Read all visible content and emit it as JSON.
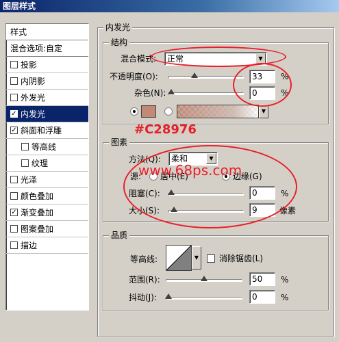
{
  "window": {
    "title": "图层样式"
  },
  "sidebar": {
    "header": "样式",
    "blend_options": "混合选项:自定",
    "items": [
      {
        "label": "投影",
        "checked": false,
        "sub": false,
        "selected": false
      },
      {
        "label": "内阴影",
        "checked": false,
        "sub": false,
        "selected": false
      },
      {
        "label": "外发光",
        "checked": false,
        "sub": false,
        "selected": false
      },
      {
        "label": "内发光",
        "checked": true,
        "sub": false,
        "selected": true
      },
      {
        "label": "斜面和浮雕",
        "checked": true,
        "sub": false,
        "selected": false
      },
      {
        "label": "等高线",
        "checked": false,
        "sub": true,
        "selected": false
      },
      {
        "label": "纹理",
        "checked": false,
        "sub": true,
        "selected": false
      },
      {
        "label": "光泽",
        "checked": false,
        "sub": false,
        "selected": false
      },
      {
        "label": "颜色叠加",
        "checked": false,
        "sub": false,
        "selected": false
      },
      {
        "label": "渐变叠加",
        "checked": true,
        "sub": false,
        "selected": false
      },
      {
        "label": "图案叠加",
        "checked": false,
        "sub": false,
        "selected": false
      },
      {
        "label": "描边",
        "checked": false,
        "sub": false,
        "selected": false
      }
    ]
  },
  "panel": {
    "title": "内发光",
    "structure": {
      "title": "结构",
      "blend_mode_label": "混合模式:",
      "blend_mode_value": "正常",
      "opacity_label": "不透明度(O):",
      "opacity_value": "33",
      "opacity_unit": "%",
      "noise_label": "杂色(N):",
      "noise_value": "0",
      "noise_unit": "%",
      "glow_color": "#C28976"
    },
    "elements": {
      "title": "图素",
      "technique_label": "方法(Q):",
      "technique_value": "柔和",
      "source_label": "源:",
      "source_center": "居中(E)",
      "source_edge": "边缘(G)",
      "choke_label": "阻塞(C):",
      "choke_value": "0",
      "choke_unit": "%",
      "size_label": "大小(S):",
      "size_value": "9",
      "size_unit": "像素"
    },
    "quality": {
      "title": "品质",
      "contour_label": "等高线:",
      "antialias_label": "消除锯齿(L)",
      "range_label": "范围(R):",
      "range_value": "50",
      "range_unit": "%",
      "jitter_label": "抖动(J):",
      "jitter_value": "0",
      "jitter_unit": "%"
    }
  },
  "annotations": {
    "color_text": "#C28976",
    "watermark": "www.68ps.com",
    "circle_color": "#e8202a"
  }
}
